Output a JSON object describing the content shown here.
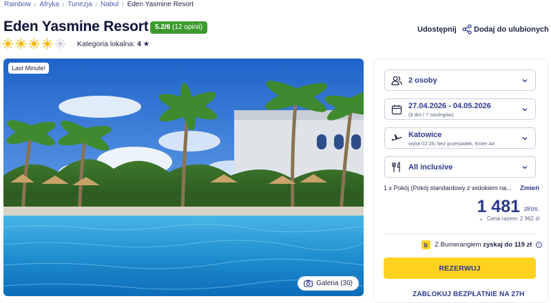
{
  "breadcrumb": [
    "Rainbow",
    "Afryka",
    "Tunezja",
    "Nabul",
    "Eden Yasmine Resort"
  ],
  "hotel": {
    "name": "Eden Yasmine Resort",
    "rating_score": "5.2/6",
    "rating_count": "(12 opinii)",
    "suns_filled": 4,
    "suns_total": 5,
    "local_category_label": "Kategoria lokalna:",
    "local_category_value": "4"
  },
  "actions": {
    "share_label": "Udostępnij",
    "favorite_label": "Dodaj do ulubionych"
  },
  "gallery": {
    "badge": "Last Minute!",
    "gallery_label": "Galeria (30)"
  },
  "booking": {
    "persons": "2 osoby",
    "dates": "27.04.2026 - 04.05.2026",
    "dates_sub": "(8 dni / 7 noclegów)",
    "departure": "Katowice",
    "departure_sub": "wylot 02:25, bez przesiadek, Enter Air",
    "board": "All inclusive",
    "room": "1 x Pokój   (Pokój standardowy z widokiem na...",
    "room_change": "Zmień",
    "price": "1 481",
    "price_unit": "zł/os.",
    "total": "Cena razem: 2 962 zł",
    "bumerang_prefix": "Z Bumerangiem",
    "bumerang_bold": "zyskaj do 119 zł",
    "book_button": "REZERWUJ",
    "block_link": "ZABLOKUJ BEZPŁATNIE NA 27H"
  },
  "colors": {
    "brand_blue": "#2a3a8e",
    "rating_green": "#3d9b2e",
    "cta_yellow": "#ffd21f",
    "sun_yellow": "#f5b400"
  }
}
